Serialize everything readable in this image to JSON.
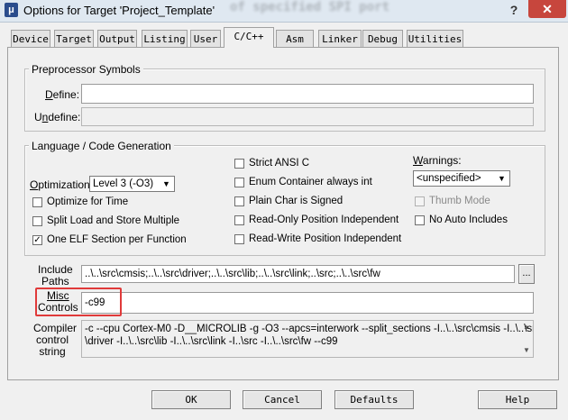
{
  "window": {
    "title": "Options for Target 'Project_Template'",
    "background_text": "of specified SPI port",
    "help_glyph": "?",
    "close_glyph": "✕"
  },
  "tabs": [
    {
      "label": "Device"
    },
    {
      "label": "Target"
    },
    {
      "label": "Output"
    },
    {
      "label": "Listing"
    },
    {
      "label": "User"
    },
    {
      "label": "C/C++"
    },
    {
      "label": "Asm"
    },
    {
      "label": "Linker"
    },
    {
      "label": "Debug"
    },
    {
      "label": "Utilities"
    }
  ],
  "active_tab": "C/C++",
  "preprocessor": {
    "title": "Preprocessor Symbols",
    "define_label": "Define:",
    "define_value": "",
    "undefine_label": "Undefine:",
    "undefine_value": ""
  },
  "language": {
    "title": "Language / Code Generation",
    "optimization_label": "Optimization:",
    "optimization_value": "Level 3 (-O3)",
    "options_left": [
      {
        "label": "Optimize for Time",
        "checked": false
      },
      {
        "label": "Split Load and Store Multiple",
        "checked": false
      },
      {
        "label": "One ELF Section per Function",
        "checked": true
      }
    ],
    "options_mid": [
      {
        "label": "Strict ANSI C",
        "checked": false
      },
      {
        "label": "Enum Container always int",
        "checked": false
      },
      {
        "label": "Plain Char is Signed",
        "checked": false
      },
      {
        "label": "Read-Only Position Independent",
        "checked": false
      },
      {
        "label": "Read-Write Position Independent",
        "checked": false
      }
    ],
    "warnings_label": "Warnings:",
    "warnings_value": "<unspecified>",
    "thumb_mode_label": "Thumb Mode",
    "thumb_mode_checked": false,
    "no_auto_includes_label": "No Auto Includes",
    "no_auto_includes_checked": false
  },
  "include_paths": {
    "label_line1": "Include",
    "label_line2": "Paths",
    "value": "..\\..\\src\\cmsis;..\\..\\src\\driver;..\\..\\src\\lib;..\\..\\src\\link;..\\src;..\\..\\src\\fw",
    "browse_label": "..."
  },
  "misc_controls": {
    "label_line1": "Misc",
    "label_line2": "Controls",
    "value": "-c99"
  },
  "compiler_string": {
    "label_line1": "Compiler",
    "label_line2": "control",
    "label_line3": "string",
    "line1": "-c --cpu Cortex-M0 -D__MICROLIB -g -O3 --apcs=interwork --split_sections -I..\\..\\src\\cmsis -I..\\..\\src",
    "line2": "\\driver -I..\\..\\src\\lib -I..\\..\\src\\link -I..\\src -I..\\..\\src\\fw --c99"
  },
  "buttons": {
    "ok": "OK",
    "cancel": "Cancel",
    "defaults": "Defaults",
    "help": "Help"
  },
  "colors": {
    "highlight": "#e03a3a",
    "close": "#c7463d"
  }
}
